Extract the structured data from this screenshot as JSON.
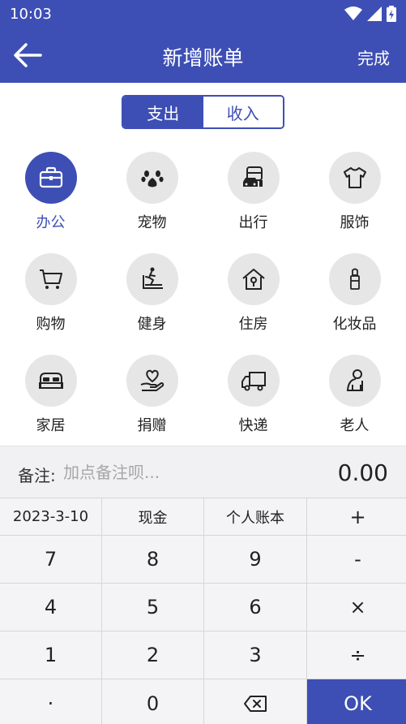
{
  "status_bar": {
    "time": "10:03"
  },
  "header": {
    "title": "新增账单",
    "done_label": "完成"
  },
  "tabs": [
    {
      "label": "支出",
      "active": true
    },
    {
      "label": "收入",
      "active": false
    }
  ],
  "categories": [
    {
      "label": "办公",
      "icon": "briefcase-icon",
      "selected": true
    },
    {
      "label": "宠物",
      "icon": "paw-icon",
      "selected": false
    },
    {
      "label": "出行",
      "icon": "vehicles-icon",
      "selected": false
    },
    {
      "label": "服饰",
      "icon": "tshirt-icon",
      "selected": false
    },
    {
      "label": "购物",
      "icon": "cart-icon",
      "selected": false
    },
    {
      "label": "健身",
      "icon": "treadmill-icon",
      "selected": false
    },
    {
      "label": "住房",
      "icon": "house-icon",
      "selected": false
    },
    {
      "label": "化妆品",
      "icon": "lipstick-icon",
      "selected": false
    },
    {
      "label": "家居",
      "icon": "bed-icon",
      "selected": false
    },
    {
      "label": "捐赠",
      "icon": "heart-hand-icon",
      "selected": false
    },
    {
      "label": "快递",
      "icon": "truck-icon",
      "selected": false
    },
    {
      "label": "老人",
      "icon": "elder-icon",
      "selected": false
    }
  ],
  "note": {
    "label": "备注:",
    "placeholder": "加点备注呗...",
    "amount": "0.00"
  },
  "keypad": {
    "date": "2023-3-10",
    "account": "现金",
    "book": "个人账本",
    "plus": "+",
    "minus": "-",
    "times": "×",
    "divide": "÷",
    "dot": "·",
    "ok": "OK",
    "digits": [
      "0",
      "1",
      "2",
      "3",
      "4",
      "5",
      "6",
      "7",
      "8",
      "9"
    ]
  },
  "colors": {
    "primary": "#3d4fb5",
    "icon_bg": "#e6e6e6",
    "keypad_bg": "#f4f4f6"
  }
}
